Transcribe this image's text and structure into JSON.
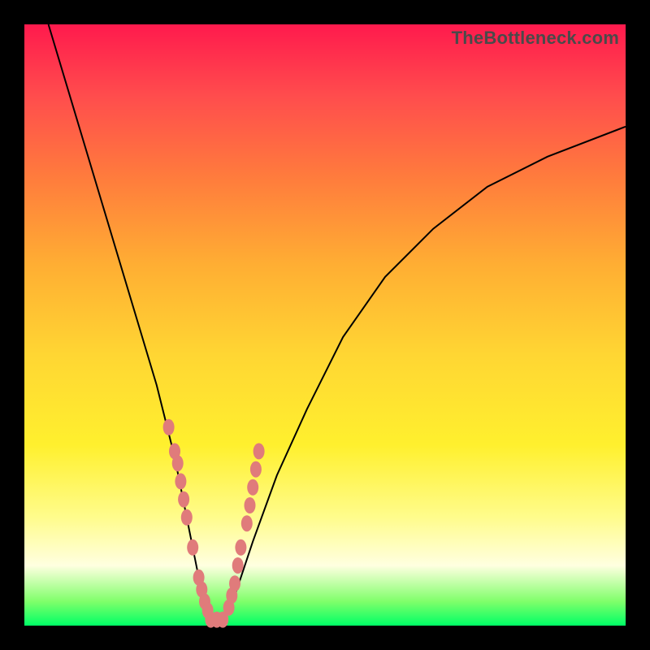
{
  "watermark": "TheBottleneck.com",
  "colors": {
    "marker": "#e07b7b",
    "curve": "#000000",
    "frame": "#000000"
  },
  "chart_data": {
    "type": "line",
    "title": "",
    "xlabel": "",
    "ylabel": "",
    "xlim": [
      0,
      100
    ],
    "ylim": [
      0,
      100
    ],
    "grid": false,
    "series": [
      {
        "name": "bottleneck-curve",
        "x": [
          4,
          7,
          10,
          13,
          16,
          19,
          22,
          25,
          27,
          29,
          30,
          31,
          32,
          33,
          35,
          38,
          42,
          47,
          53,
          60,
          68,
          77,
          87,
          100
        ],
        "values": [
          100,
          90,
          80,
          70,
          60,
          50,
          40,
          28,
          18,
          8,
          4,
          1,
          1,
          1,
          5,
          14,
          25,
          36,
          48,
          58,
          66,
          73,
          78,
          83
        ]
      }
    ],
    "markers": {
      "name": "highlighted-points",
      "x": [
        24,
        25,
        25.5,
        26,
        26.5,
        27,
        28,
        29,
        29.5,
        30,
        30.5,
        31,
        32,
        33,
        34,
        34.5,
        35,
        35.5,
        36,
        37,
        37.5,
        38,
        38.5,
        39
      ],
      "values": [
        33,
        29,
        27,
        24,
        21,
        18,
        13,
        8,
        6,
        4,
        2.5,
        1,
        1,
        1,
        3,
        5,
        7,
        10,
        13,
        17,
        20,
        23,
        26,
        29
      ]
    }
  }
}
